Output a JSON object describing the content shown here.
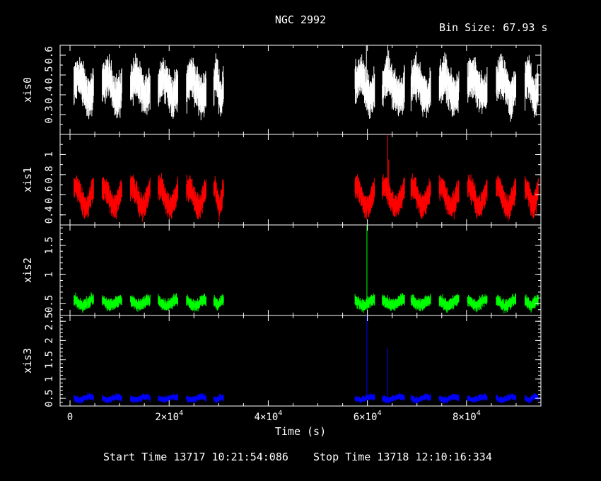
{
  "chart_data": {
    "type": "line",
    "title": "NGC 2992",
    "bin_size_label": "Bin Size: 67.93 s",
    "xlabel": "Time (s)",
    "xlim": [
      -2000,
      95000
    ],
    "x_ticks": [
      {
        "value": 0,
        "label": "0",
        "exp": ""
      },
      {
        "value": 20000,
        "label": "2×10",
        "exp": "4"
      },
      {
        "value": 40000,
        "label": "4×10",
        "exp": "4"
      },
      {
        "value": 60000,
        "label": "6×10",
        "exp": "4"
      },
      {
        "value": 80000,
        "label": "8×10",
        "exp": "4"
      }
    ],
    "start_time": "Start Time 13717 10:21:54:086",
    "stop_time": "Stop Time 13718 12:10:16:334",
    "good_time_intervals": [
      [
        800,
        4800
      ],
      [
        6500,
        10500
      ],
      [
        12200,
        16200
      ],
      [
        17800,
        21800
      ],
      [
        23500,
        27500
      ],
      [
        29000,
        31000
      ],
      [
        57500,
        61500
      ],
      [
        63000,
        67500
      ],
      [
        68800,
        72800
      ],
      [
        74500,
        78500
      ],
      [
        80200,
        84200
      ],
      [
        86000,
        90000
      ],
      [
        91800,
        94500
      ]
    ],
    "series": [
      {
        "name": "xis0",
        "color": "#ffffff",
        "ylim": [
          0.2,
          0.65
        ],
        "yticks": [
          0.3,
          0.4,
          0.5,
          0.6
        ],
        "ytick_labels": [
          "0.3",
          "0.4",
          "0.5",
          "0.6"
        ],
        "minor_step": 0.05,
        "mean": 0.44,
        "amplitude": 0.05,
        "noise": 0.06,
        "spikes": [
          [
            59800,
            0.65
          ],
          [
            64100,
            0.65
          ]
        ]
      },
      {
        "name": "xis1",
        "color": "#ff0000",
        "ylim": [
          0.3,
          1.2
        ],
        "yticks": [
          0.4,
          0.6,
          0.8,
          1.0
        ],
        "ytick_labels": [
          "0.4",
          "0.6",
          "0.8",
          "1"
        ],
        "minor_step": 0.1,
        "mean": 0.58,
        "amplitude": 0.1,
        "noise": 0.07,
        "spikes": [
          [
            64100,
            1.2
          ],
          [
            64300,
            0.95
          ]
        ]
      },
      {
        "name": "xis2",
        "color": "#00ff00",
        "ylim": [
          0.3,
          1.85
        ],
        "yticks": [
          0.5,
          1.0,
          1.5
        ],
        "ytick_labels": [
          "0.5",
          "1",
          "1.5"
        ],
        "minor_step": 0.1,
        "mean": 0.52,
        "amplitude": 0.05,
        "noise": 0.06,
        "spikes": [
          [
            59900,
            1.85
          ],
          [
            64100,
            0.65
          ]
        ]
      },
      {
        "name": "xis3",
        "color": "#0000ff",
        "ylim": [
          0.3,
          2.65
        ],
        "yticks": [
          0.5,
          1.0,
          1.5,
          2.0,
          2.5
        ],
        "ytick_labels": [
          "0.5",
          "1",
          "1.5",
          "2",
          "2.5"
        ],
        "minor_step": 0.1,
        "mean": 0.5,
        "amplitude": 0.04,
        "noise": 0.05,
        "spikes": [
          [
            59900,
            2.65
          ],
          [
            64100,
            1.8
          ]
        ]
      }
    ]
  }
}
